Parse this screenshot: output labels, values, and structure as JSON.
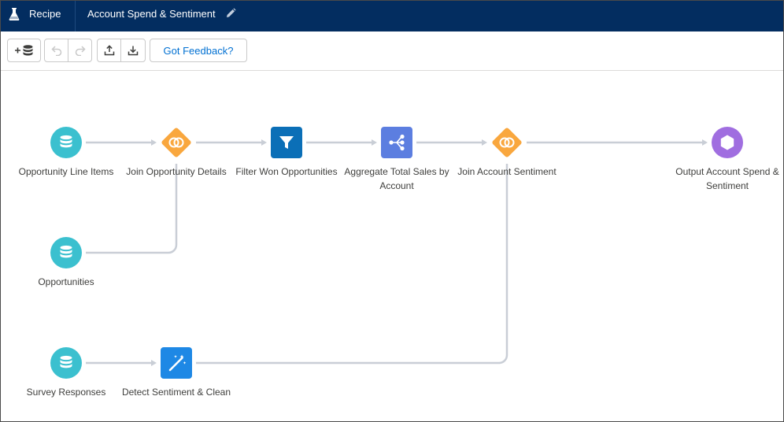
{
  "header": {
    "app_label": "Recipe",
    "title": "Account Spend & Sentiment"
  },
  "toolbar": {
    "feedback_label": "Got Feedback?"
  },
  "nodes": [
    {
      "id": "opportunity-line-items",
      "label": "Opportunity Line Items",
      "type": "input",
      "color": "#3bc0cf"
    },
    {
      "id": "join-opportunity-details",
      "label": "Join Opportunity Details",
      "type": "join",
      "color": "#f9a73e"
    },
    {
      "id": "filter-won-opportunities",
      "label": "Filter Won Opportunities",
      "type": "filter",
      "color": "#0b6fb7"
    },
    {
      "id": "aggregate-total-sales",
      "label": "Aggregate Total Sales by Account",
      "type": "aggregate",
      "color": "#5c7ee0"
    },
    {
      "id": "join-account-sentiment",
      "label": "Join Account Sentiment",
      "type": "join",
      "color": "#f9a73e"
    },
    {
      "id": "output-account-spend",
      "label": "Output Account Spend & Sentiment",
      "type": "output",
      "color": "#a06ee0"
    },
    {
      "id": "opportunities",
      "label": "Opportunities",
      "type": "input",
      "color": "#3bc0cf"
    },
    {
      "id": "survey-responses",
      "label": "Survey Responses",
      "type": "input",
      "color": "#3bc0cf"
    },
    {
      "id": "detect-sentiment-clean",
      "label": "Detect Sentiment & Clean",
      "type": "transform",
      "color": "#1e88e5"
    }
  ],
  "icons": {
    "app": "flask-icon",
    "edit": "pencil-icon",
    "add_data": "add-data-icon",
    "undo": "undo-icon",
    "redo": "redo-icon",
    "upload": "upload-icon",
    "download": "download-icon"
  },
  "colors": {
    "header_bg": "#032d60",
    "link": "#0070d2",
    "connector": "#c9ced6"
  }
}
